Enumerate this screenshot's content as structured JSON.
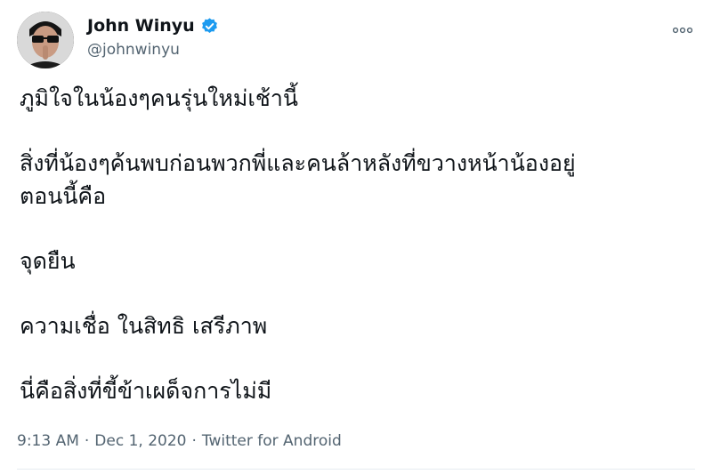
{
  "author": {
    "display_name": "John Winyu",
    "handle": "@johnwinyu",
    "verified": true
  },
  "tweet": {
    "paragraphs": [
      "ภูมิใจในน้องๆคนรุ่นใหม่เช้านี้",
      "สิ่งที่น้องๆค้นพบก่อนพวกพี่และคนล้าหลังที่ขวางหน้าน้องอยู่\nตอนนี้คือ",
      "จุดยืน",
      "ความเชื่อ ในสิทธิ เสรีภาพ",
      "นี่คือสิ่งที่ขี้ข้าเผด็จการไม่มี"
    ],
    "time": "9:13 AM",
    "date": "Dec 1, 2020",
    "source": "Twitter for Android",
    "separator": "·"
  },
  "icons": {
    "more": "more-options-icon",
    "verified": "verified-badge-icon"
  },
  "colors": {
    "text": "#0f1419",
    "secondary": "#536471",
    "verified": "#1d9bf0"
  }
}
